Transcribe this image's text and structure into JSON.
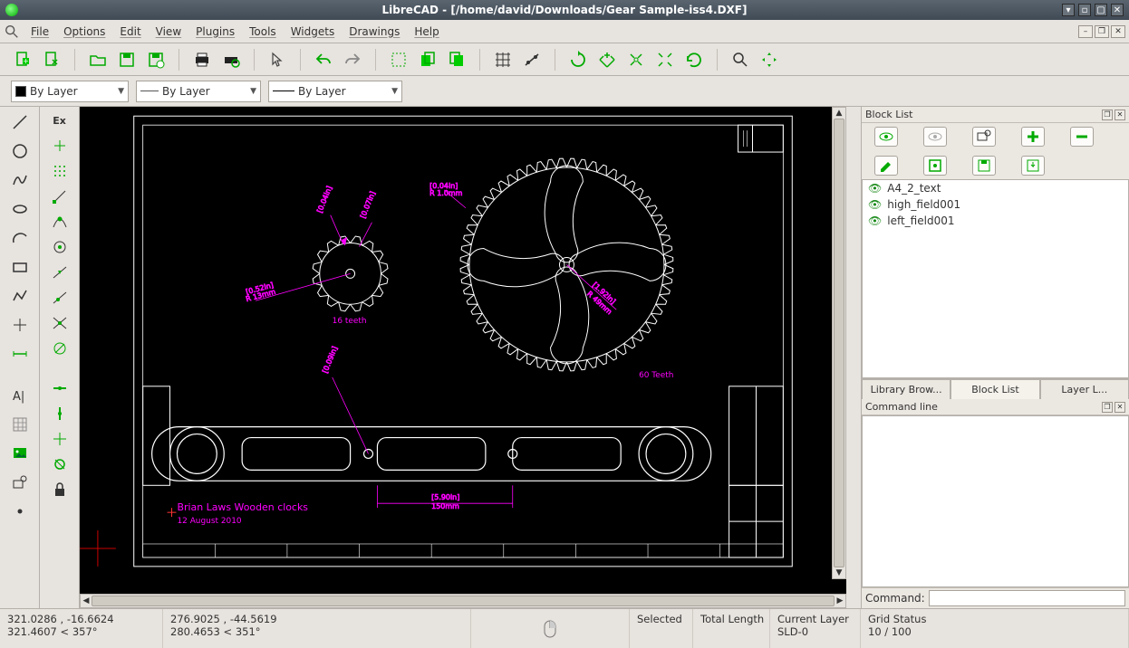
{
  "window": {
    "title": "LibreCAD - [/home/david/Downloads/Gear Sample-iss4.DXF]"
  },
  "menu": {
    "items": [
      "File",
      "Options",
      "Edit",
      "View",
      "Plugins",
      "Tools",
      "Widgets",
      "Drawings",
      "Help"
    ]
  },
  "prop": {
    "color": "By Layer",
    "width": "By Layer",
    "linetype": "By Layer"
  },
  "blocklist": {
    "title": "Block List",
    "items": [
      "A4_2_text",
      "high_field001",
      "left_field001"
    ]
  },
  "tabs": {
    "library": "Library Brow...",
    "block": "Block List",
    "layer": "Layer L..."
  },
  "commandline": {
    "title": "Command line",
    "prompt": "Command:"
  },
  "status": {
    "abs_coord": "321.0286 , -16.6624",
    "polar_coord": "321.4607 < 357°",
    "rel_coord": "276.9025 , -44.5619",
    "rel_polar": "280.4653 < 351°",
    "selected_label": "Selected",
    "total_len_label": "Total Length",
    "layer_label": "Current Layer",
    "layer_value": "SLD-0",
    "grid_label": "Grid Status",
    "grid_value": "10 / 100"
  },
  "drawing": {
    "small_gear_label": "16 teeth",
    "big_gear_label": "60 Teeth",
    "author": "Brian Laws Wooden clocks",
    "date": "12 August 2010"
  }
}
